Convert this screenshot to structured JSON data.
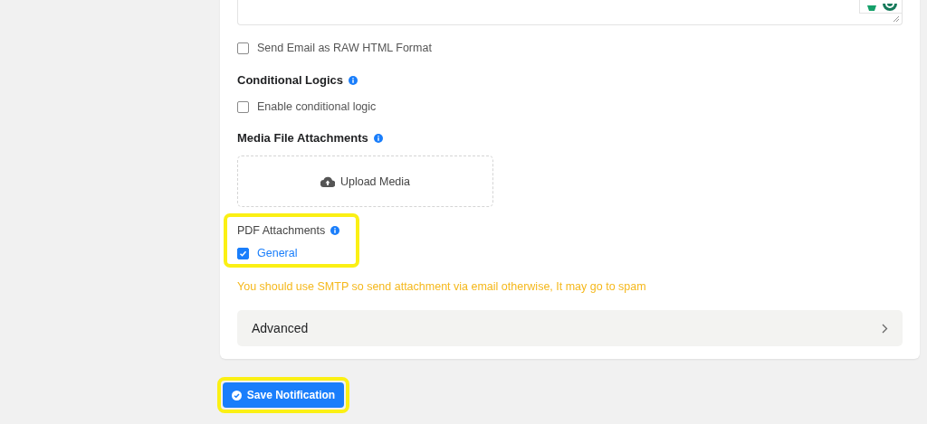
{
  "editor": {
    "resizable": true
  },
  "raw_html": {
    "label": "Send Email as RAW HTML Format",
    "checked": false
  },
  "conditional_logics": {
    "title": "Conditional Logics",
    "option": {
      "label": "Enable conditional logic",
      "checked": false
    }
  },
  "media_attachments": {
    "title": "Media File Attachments",
    "upload_button": "Upload Media"
  },
  "pdf_attachments": {
    "title": "PDF Attachments",
    "highlighted": true,
    "options": [
      {
        "label": "General",
        "checked": true
      }
    ]
  },
  "warning": "You should use SMTP so send attachment via email otherwise, It may go to spam",
  "advanced": {
    "label": "Advanced",
    "expanded": false
  },
  "save_button": {
    "label": "Save Notification",
    "highlighted": true
  }
}
